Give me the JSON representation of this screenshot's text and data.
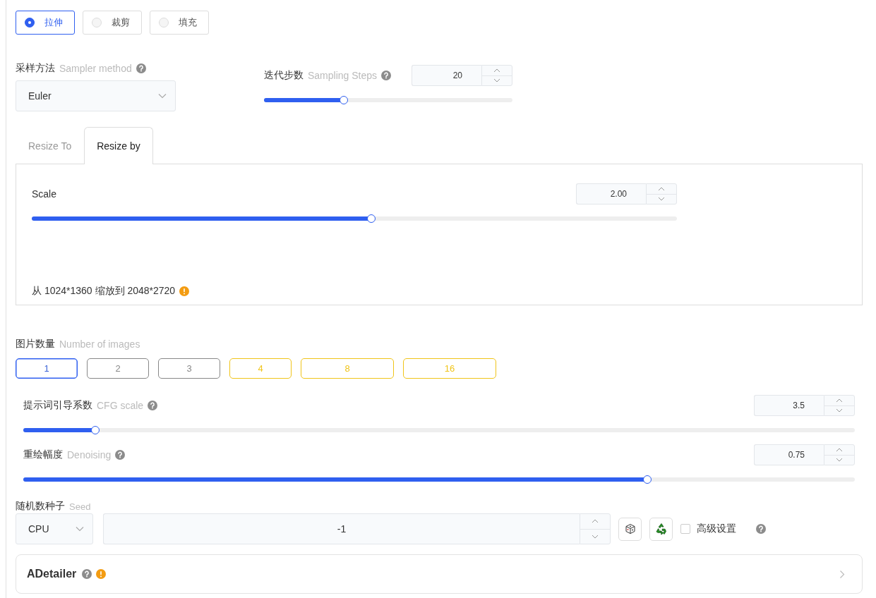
{
  "resize_modes": [
    {
      "label": "拉伸",
      "selected": true
    },
    {
      "label": "裁剪",
      "selected": false
    },
    {
      "label": "填充",
      "selected": false
    }
  ],
  "sampler": {
    "label": "采样方法",
    "hint": "Sampler method",
    "value": "Euler"
  },
  "steps": {
    "label": "迭代步数",
    "hint": "Sampling Steps",
    "value": "20",
    "level": 0.32
  },
  "tabs": [
    {
      "label": "Resize To",
      "selected": false
    },
    {
      "label": "Resize by",
      "selected": true
    }
  ],
  "scale": {
    "label": "Scale",
    "value": "2.00",
    "level": 0.526
  },
  "resize_info": "从 1024*1360 缩放到 2048*2720",
  "images": {
    "label": "图片数量",
    "hint": "Number of images",
    "options": [
      {
        "label": "1",
        "selected": true,
        "color": "#3a62d7"
      },
      {
        "label": "2",
        "selected": false,
        "color": "#888888"
      },
      {
        "label": "3",
        "selected": false,
        "color": "#888888"
      },
      {
        "label": "4",
        "selected": false,
        "color": "#f0c419"
      },
      {
        "label": "8",
        "selected": false,
        "color": "#f0c419"
      },
      {
        "label": "16",
        "selected": false,
        "color": "#f0c419"
      }
    ]
  },
  "cfg": {
    "label": "提示词引导系数",
    "hint": "CFG scale",
    "value": "3.5",
    "level": 0.087
  },
  "denoising": {
    "label": "重绘幅度",
    "hint": "Denoising",
    "value": "0.75",
    "level": 0.75
  },
  "seed": {
    "label": "随机数种子",
    "hint": "Seed",
    "device": "CPU",
    "value": "-1"
  },
  "advanced": {
    "label": "高级设置",
    "checked": false
  },
  "adetailer": {
    "title": "ADetailer"
  }
}
